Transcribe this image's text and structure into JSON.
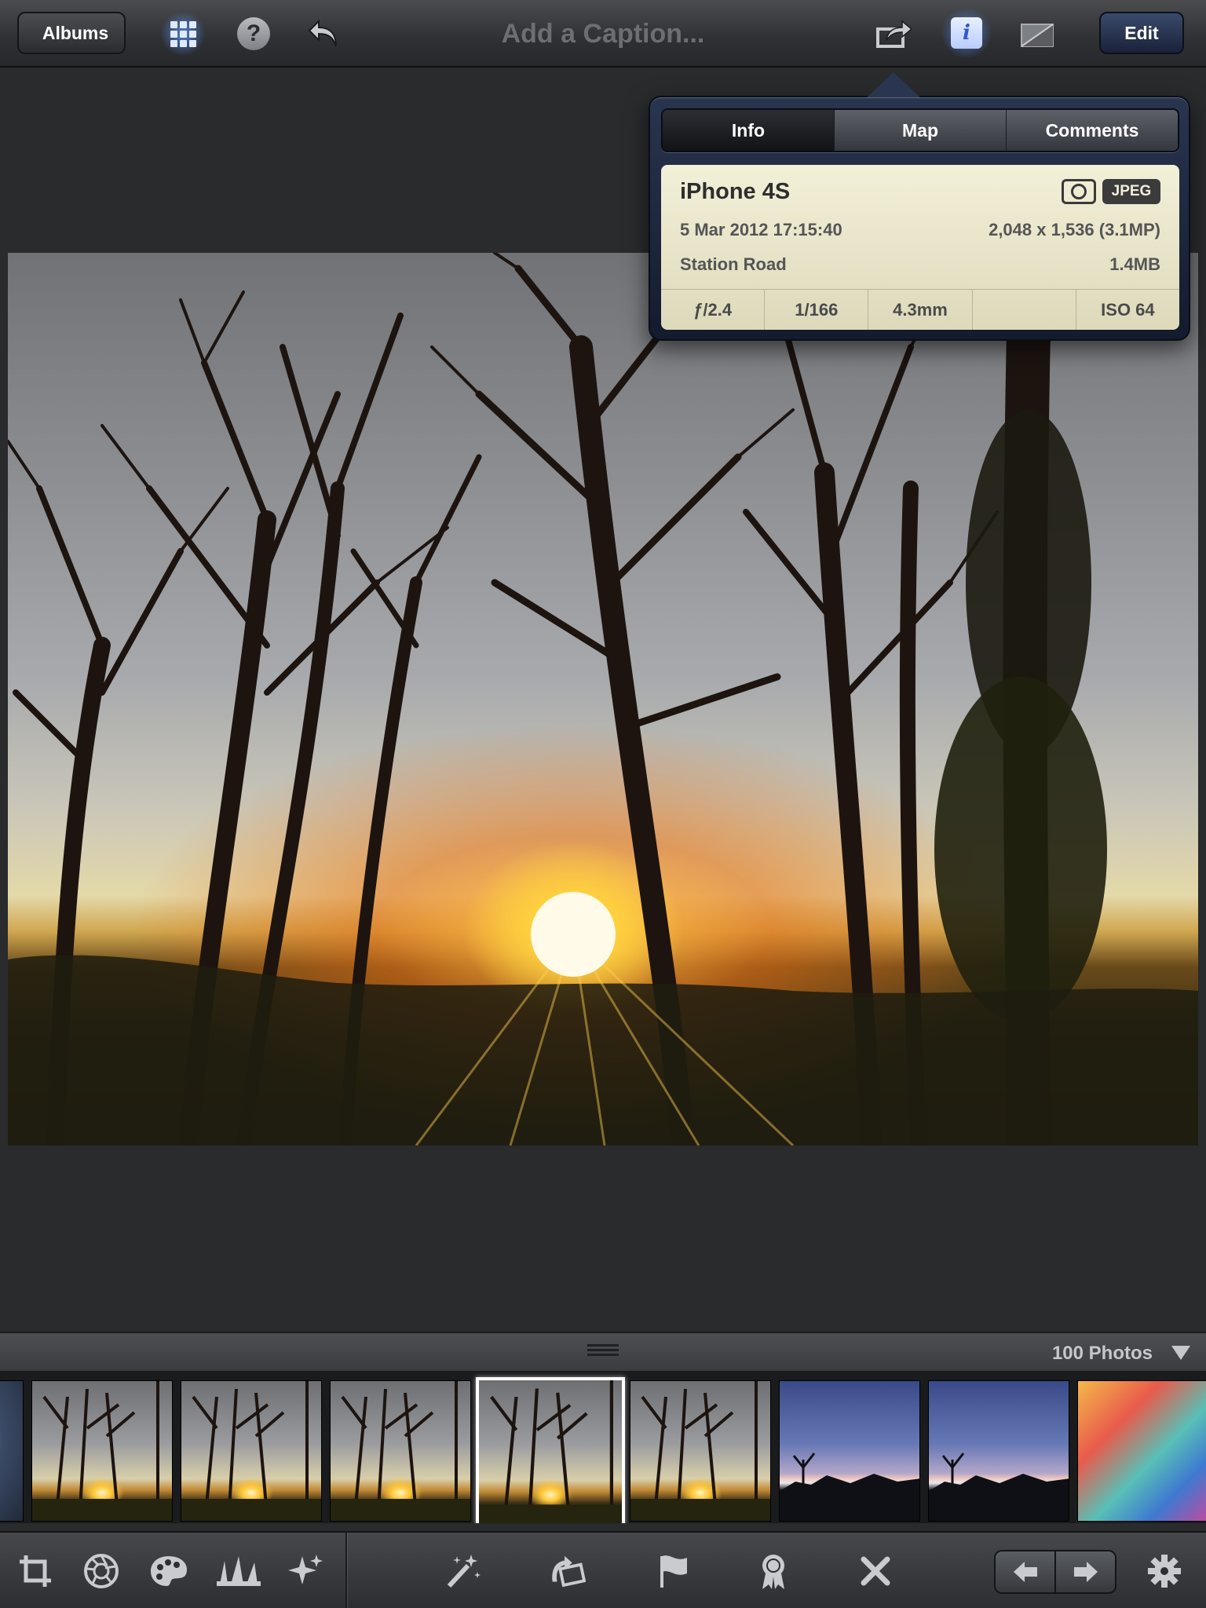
{
  "topbar": {
    "albums_label": "Albums",
    "caption_placeholder": "Add a Caption...",
    "edit_label": "Edit",
    "icons": [
      "grid-icon",
      "help-icon",
      "undo-icon",
      "share-icon",
      "info-icon",
      "compare-icon"
    ]
  },
  "popover": {
    "tabs": [
      {
        "label": "Info",
        "active": true
      },
      {
        "label": "Map",
        "active": false
      },
      {
        "label": "Comments",
        "active": false
      }
    ],
    "camera_model": "iPhone 4S",
    "format_badge": "JPEG",
    "datetime": "5 Mar 2012 17:15:40",
    "dimensions": "2,048 x 1,536 (3.1MP)",
    "location": "Station Road",
    "file_size": "1.4MB",
    "exif": {
      "aperture": "ƒ/2.4",
      "shutter": "1/166",
      "focal_length": "4.3mm",
      "blank": "",
      "iso": "ISO 64"
    }
  },
  "filmstrip": {
    "count_label": "100 Photos",
    "thumbnails": [
      "plate",
      "sunset",
      "sunset",
      "sunset",
      "sunset-selected",
      "sunset",
      "dusk",
      "dusk",
      "play"
    ]
  },
  "bottombar": {
    "left_tools": [
      "crop-icon",
      "aperture-icon",
      "palette-icon",
      "brushes-icon",
      "effects-sparkle-icon"
    ],
    "center_tools": [
      "auto-enhance-wand-icon",
      "rotate-icon",
      "flag-icon",
      "award-icon",
      "reject-x-icon"
    ],
    "right_tools": [
      "previous-arrow-icon",
      "next-arrow-icon",
      "settings-gear-icon"
    ]
  },
  "colors": {
    "toolbar": "#2e3033",
    "info_card": "#f2f0d8",
    "popover": "#1b2438",
    "accent_glow": "#5a96ff"
  }
}
